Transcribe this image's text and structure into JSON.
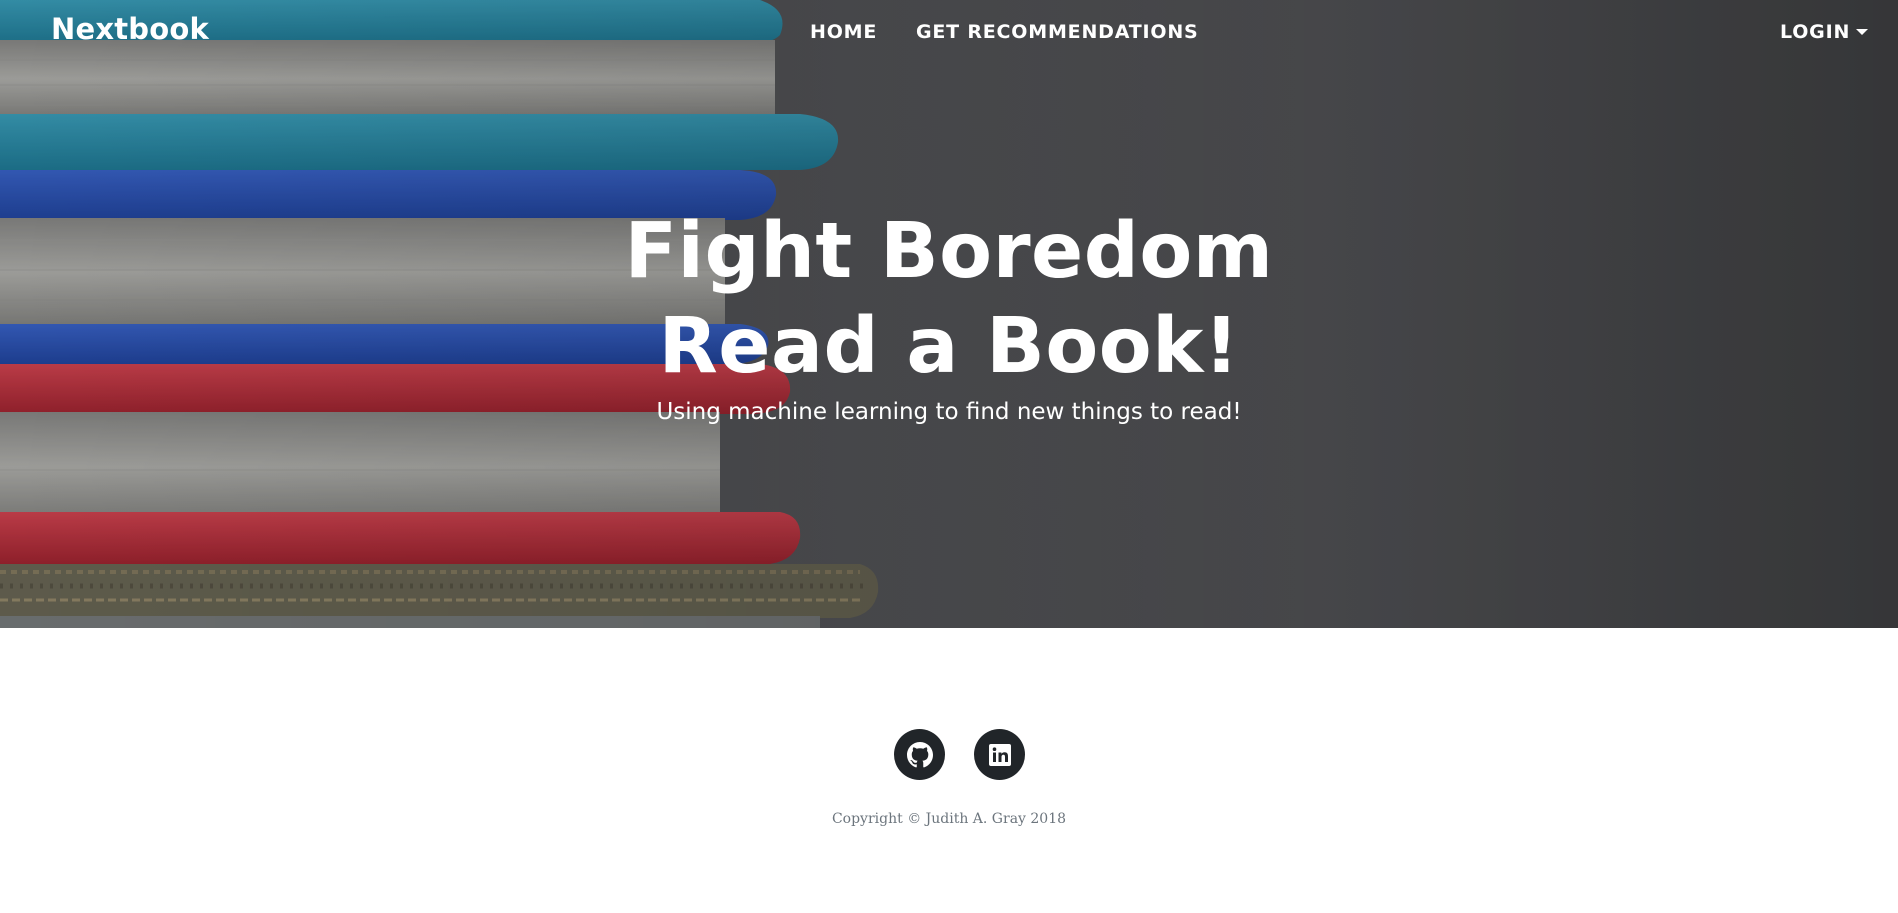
{
  "navbar": {
    "brand": "Nextbook",
    "links": [
      {
        "label": "HOME"
      },
      {
        "label": "GET RECOMMENDATIONS"
      }
    ],
    "login": {
      "label": "LOGIN",
      "icon": "caret-down-icon"
    }
  },
  "hero": {
    "heading_line1": "Fight Boredom",
    "heading_line2": "Read a Book!",
    "subheading": "Using machine learning to find new things to read!",
    "image": "stack-of-books-photo"
  },
  "footer": {
    "social": [
      {
        "icon": "github-icon"
      },
      {
        "icon": "linkedin-icon"
      }
    ],
    "copyright": "Copyright © Judith A. Gray 2018"
  },
  "colors": {
    "hero_background": "#58595d",
    "footer_icon_background": "#212529",
    "copyright_text": "#6c757d",
    "book_teal": "#2b93b3",
    "book_blue": "#2a56c4",
    "book_red": "#c9313f"
  }
}
